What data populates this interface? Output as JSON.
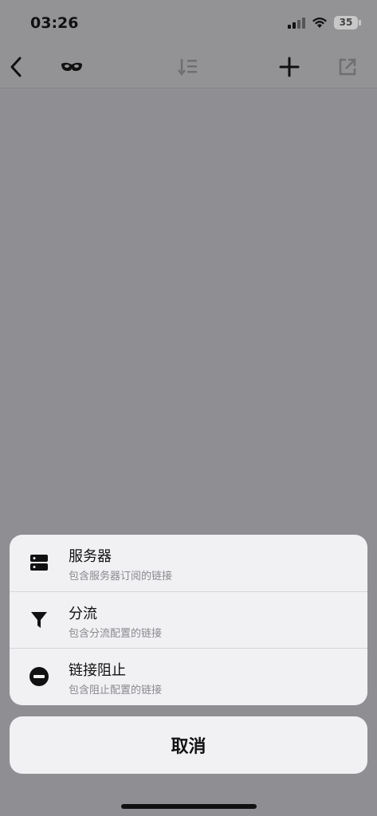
{
  "status": {
    "time": "03:26",
    "battery": "35"
  },
  "navbar": {
    "back_icon": "chevron-left-icon",
    "mask_icon": "mask-icon",
    "sort_icon": "sort-icon",
    "add_icon": "plus-icon",
    "share_icon": "open-external-icon"
  },
  "sheet": {
    "items": [
      {
        "title": "服务器",
        "subtitle": "包含服务器订阅的链接",
        "icon": "server-icon"
      },
      {
        "title": "分流",
        "subtitle": "包含分流配置的链接",
        "icon": "filter-icon"
      },
      {
        "title": "链接阻止",
        "subtitle": "包含阻止配置的链接",
        "icon": "block-icon"
      }
    ],
    "cancel_label": "取消"
  }
}
